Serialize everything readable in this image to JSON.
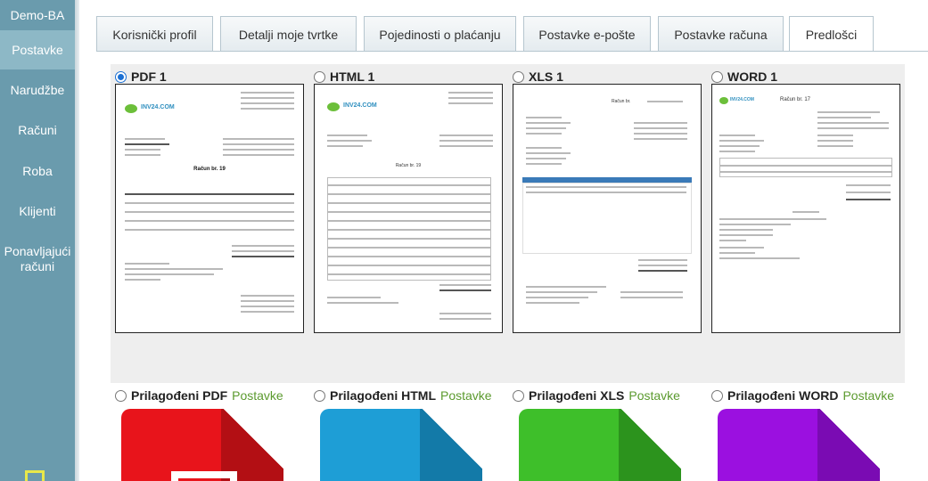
{
  "sidebar": {
    "brand": "Demo-BA",
    "items": [
      {
        "label": "Postavke",
        "active": true
      },
      {
        "label": "Narudžbe"
      },
      {
        "label": "Računi"
      },
      {
        "label": "Roba"
      },
      {
        "label": "Klijenti"
      },
      {
        "label": "Ponavljajući računi"
      }
    ]
  },
  "tabs": [
    {
      "label": "Korisnički profil"
    },
    {
      "label": "Detalji moje tvrtke"
    },
    {
      "label": "Pojedinosti o plaćanju"
    },
    {
      "label": "Postavke e-pošte"
    },
    {
      "label": "Postavke računa"
    },
    {
      "label": "Predlošci",
      "active": true
    }
  ],
  "templates": [
    {
      "label": "PDF 1",
      "checked": true,
      "preview": {
        "logo": "INV24.COM",
        "title": "Račun br. 19"
      }
    },
    {
      "label": "HTML 1",
      "checked": false,
      "preview": {
        "logo": "INV24.COM",
        "title": "Račun br. 19"
      }
    },
    {
      "label": "XLS 1",
      "checked": false,
      "preview": {
        "title": "Račun br."
      }
    },
    {
      "label": "WORD 1",
      "checked": false,
      "preview": {
        "logo": "INV24.COM",
        "title": "Račun br. 17"
      }
    }
  ],
  "custom_templates": [
    {
      "label": "Prilagođeni PDF",
      "link": "Postavke",
      "color": "#e8141b",
      "fold": "#b30f14"
    },
    {
      "label": "Prilagođeni HTML",
      "link": "Postavke",
      "color": "#1e9ed6",
      "fold": "#137aa8"
    },
    {
      "label": "Prilagođeni XLS",
      "link": "Postavke",
      "color": "#3ebf2a",
      "fold": "#2c931d"
    },
    {
      "label": "Prilagođeni WORD",
      "link": "Postavke",
      "color": "#9b10e0",
      "fold": "#7a0bb3"
    }
  ],
  "colors": {
    "sidebar": "#6a9bad",
    "active_nav": "#8db8c6",
    "link": "#5b9a2e",
    "radio": "#1a6fd3"
  }
}
